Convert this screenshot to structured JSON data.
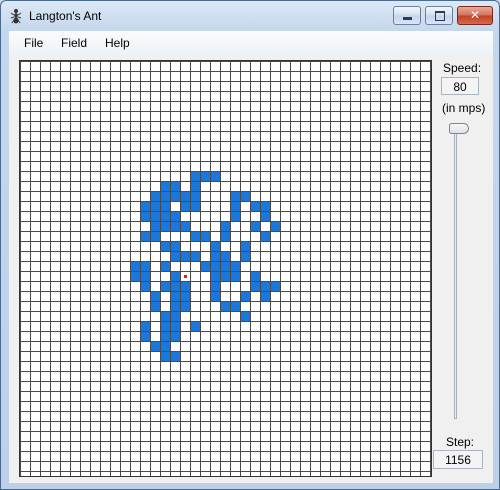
{
  "window": {
    "title": "Langton's Ant",
    "close_glyph": "✕"
  },
  "menu": {
    "items": [
      "File",
      "Field",
      "Help"
    ]
  },
  "sidebar": {
    "speed_label": "Speed:",
    "speed_value": "80",
    "speed_unit": "(in mps)",
    "step_label": "Step:",
    "step_value": "1156"
  },
  "colors": {
    "cell_alive": "#1a78dc",
    "ant": "#e02020",
    "grid_line": "#4a4a4a"
  },
  "field": {
    "columns": 41,
    "rows": 41,
    "ant": [
      16,
      21
    ],
    "black_cells": [
      [
        17,
        11
      ],
      [
        18,
        11
      ],
      [
        19,
        11
      ],
      [
        14,
        12
      ],
      [
        15,
        12
      ],
      [
        17,
        12
      ],
      [
        13,
        13
      ],
      [
        14,
        13
      ],
      [
        15,
        13
      ],
      [
        16,
        13
      ],
      [
        17,
        13
      ],
      [
        21,
        13
      ],
      [
        22,
        13
      ],
      [
        12,
        14
      ],
      [
        13,
        14
      ],
      [
        14,
        14
      ],
      [
        16,
        14
      ],
      [
        17,
        14
      ],
      [
        21,
        14
      ],
      [
        23,
        14
      ],
      [
        24,
        14
      ],
      [
        12,
        15
      ],
      [
        13,
        15
      ],
      [
        14,
        15
      ],
      [
        15,
        15
      ],
      [
        21,
        15
      ],
      [
        24,
        15
      ],
      [
        13,
        16
      ],
      [
        14,
        16
      ],
      [
        15,
        16
      ],
      [
        16,
        16
      ],
      [
        20,
        16
      ],
      [
        23,
        16
      ],
      [
        25,
        16
      ],
      [
        12,
        17
      ],
      [
        13,
        17
      ],
      [
        17,
        17
      ],
      [
        18,
        17
      ],
      [
        20,
        17
      ],
      [
        24,
        17
      ],
      [
        14,
        18
      ],
      [
        15,
        18
      ],
      [
        19,
        18
      ],
      [
        22,
        18
      ],
      [
        15,
        19
      ],
      [
        16,
        19
      ],
      [
        17,
        19
      ],
      [
        19,
        19
      ],
      [
        20,
        19
      ],
      [
        22,
        19
      ],
      [
        11,
        20
      ],
      [
        12,
        20
      ],
      [
        14,
        20
      ],
      [
        18,
        20
      ],
      [
        19,
        20
      ],
      [
        20,
        20
      ],
      [
        21,
        20
      ],
      [
        11,
        21
      ],
      [
        12,
        21
      ],
      [
        15,
        21
      ],
      [
        19,
        21
      ],
      [
        20,
        21
      ],
      [
        21,
        21
      ],
      [
        23,
        21
      ],
      [
        12,
        22
      ],
      [
        14,
        22
      ],
      [
        15,
        22
      ],
      [
        16,
        22
      ],
      [
        19,
        22
      ],
      [
        23,
        22
      ],
      [
        24,
        22
      ],
      [
        25,
        22
      ],
      [
        13,
        23
      ],
      [
        15,
        23
      ],
      [
        16,
        23
      ],
      [
        19,
        23
      ],
      [
        22,
        23
      ],
      [
        24,
        23
      ],
      [
        13,
        24
      ],
      [
        15,
        24
      ],
      [
        16,
        24
      ],
      [
        20,
        24
      ],
      [
        21,
        24
      ],
      [
        14,
        25
      ],
      [
        15,
        25
      ],
      [
        22,
        25
      ],
      [
        12,
        26
      ],
      [
        14,
        26
      ],
      [
        15,
        26
      ],
      [
        17,
        26
      ],
      [
        12,
        27
      ],
      [
        14,
        27
      ],
      [
        15,
        27
      ],
      [
        13,
        28
      ],
      [
        14,
        28
      ],
      [
        14,
        29
      ],
      [
        15,
        29
      ]
    ]
  }
}
